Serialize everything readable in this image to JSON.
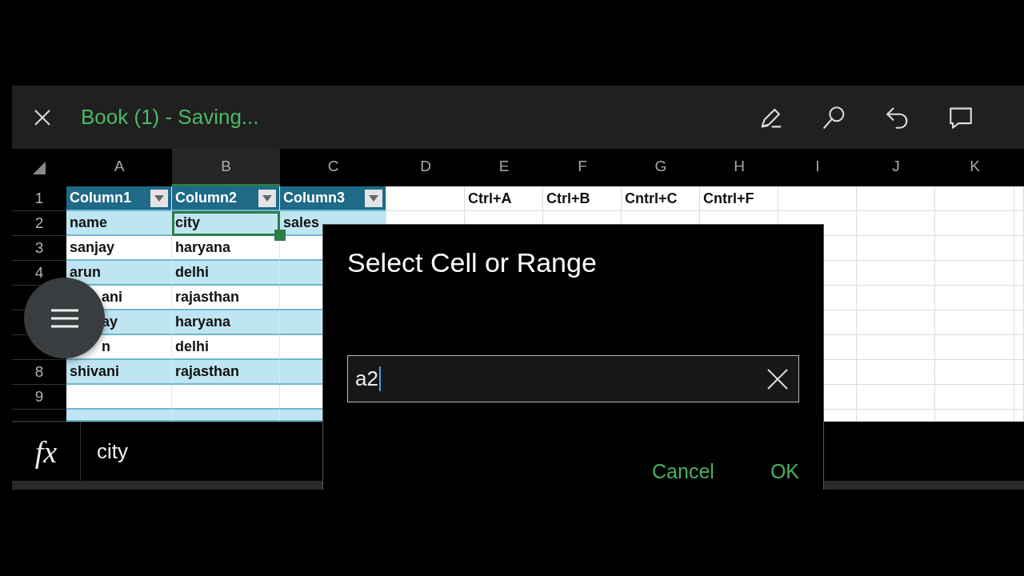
{
  "title_bar": {
    "title": "Book (1) - Saving..."
  },
  "columns": [
    {
      "label": "A",
      "selected": false
    },
    {
      "label": "B",
      "selected": true
    },
    {
      "label": "C",
      "selected": false
    },
    {
      "label": "D",
      "selected": false
    },
    {
      "label": "E",
      "selected": false
    },
    {
      "label": "F",
      "selected": false
    },
    {
      "label": "G",
      "selected": false
    },
    {
      "label": "H",
      "selected": false
    },
    {
      "label": "I",
      "selected": false
    },
    {
      "label": "J",
      "selected": false
    },
    {
      "label": "K",
      "selected": false
    }
  ],
  "rows": [
    {
      "number": "1",
      "kind": "header",
      "cells": [
        {
          "text": "Column1",
          "filter": true
        },
        {
          "text": "Column2",
          "filter": true
        },
        {
          "text": "Column3",
          "filter": true
        },
        {},
        {
          "text": "Ctrl+A"
        },
        {
          "text": "Ctrl+B"
        },
        {
          "text": "Cntrl+C"
        },
        {
          "text": "Cntrl+F"
        },
        {},
        {},
        {}
      ]
    },
    {
      "number": "2",
      "kind": "data",
      "striped": true,
      "cells": [
        {
          "text": "name",
          "selected": false
        },
        {
          "text": "city",
          "selected": true
        },
        {
          "text": "sales",
          "selected": false
        },
        {},
        {},
        {},
        {},
        {},
        {},
        {},
        {}
      ]
    },
    {
      "number": "3",
      "kind": "data",
      "striped": false,
      "cells": [
        {
          "text": "sanjay",
          "selected": false
        },
        {
          "text": "haryana",
          "selected": false
        },
        {
          "selected": false
        },
        {},
        {},
        {},
        {},
        {},
        {},
        {},
        {}
      ]
    },
    {
      "number": "4",
      "kind": "data",
      "striped": true,
      "cells": [
        {
          "text": "arun",
          "selected": false
        },
        {
          "text": "delhi",
          "selected": false
        },
        {
          "selected": false
        },
        {},
        {},
        {},
        {},
        {},
        {},
        {},
        {}
      ]
    },
    {
      "kind": "data",
      "striped": false,
      "cells": [
        {
          "text": "ani",
          "selected": false,
          "partial": true
        },
        {
          "text": "rajasthan",
          "selected": false
        },
        {
          "selected": false
        },
        {},
        {},
        {},
        {},
        {},
        {},
        {},
        {}
      ]
    },
    {
      "kind": "data",
      "striped": true,
      "cells": [
        {
          "text": "ay",
          "selected": false,
          "partial": true
        },
        {
          "text": "haryana",
          "selected": false
        },
        {
          "selected": false
        },
        {},
        {},
        {},
        {},
        {},
        {},
        {},
        {}
      ]
    },
    {
      "kind": "data",
      "striped": false,
      "cells": [
        {
          "text": "n",
          "selected": false,
          "partial": true
        },
        {
          "text": "delhi",
          "selected": false
        },
        {
          "selected": false
        },
        {},
        {},
        {},
        {},
        {},
        {},
        {},
        {}
      ]
    },
    {
      "number": "8",
      "kind": "data",
      "striped": true,
      "cells": [
        {
          "text": "shivani",
          "selected": false
        },
        {
          "text": "rajasthan",
          "selected": false
        },
        {
          "selected": false
        },
        {},
        {},
        {},
        {},
        {},
        {},
        {},
        {}
      ]
    },
    {
      "number": "9",
      "kind": "data",
      "striped": false,
      "cells": [
        {
          "selected": false
        },
        {
          "selected": false
        },
        {
          "selected": false
        },
        {},
        {},
        {},
        {},
        {},
        {},
        {},
        {}
      ]
    },
    {
      "kind": "data",
      "striped": true,
      "cells": [
        {
          "selected": false
        },
        {
          "selected": false
        },
        {
          "selected": false
        },
        {},
        {},
        {},
        {},
        {},
        {},
        {},
        {}
      ]
    }
  ],
  "formula_bar": {
    "label": "fx",
    "value": "city"
  },
  "dialog": {
    "title": "Select Cell or Range",
    "input": "a2",
    "buttons": [
      "Cancel",
      "OK"
    ]
  }
}
